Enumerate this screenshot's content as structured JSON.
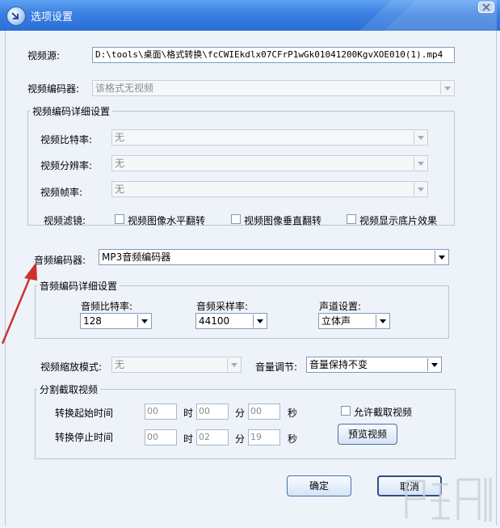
{
  "window": {
    "title": "选项设置"
  },
  "video": {
    "source_label": "视频源:",
    "source_path": "D:\\tools\\桌面\\格式转换\\fcCWIEkdlx07CFrP1wGk01041200KgvXOE010(1).mp4",
    "encoder_label": "视频编码器:",
    "encoder_value": "该格式无视频",
    "detail_title": "视频编码详细设置",
    "bitrate_label": "视频比特率:",
    "bitrate_value": "无",
    "resolution_label": "视频分辨率:",
    "resolution_value": "无",
    "framerate_label": "视频帧率:",
    "framerate_value": "无",
    "filter_label": "视频滤镜:",
    "filter_options": [
      "视频图像水平翻转",
      "视频图像垂直翻转",
      "视频显示底片效果"
    ]
  },
  "audio": {
    "encoder_label": "音频编码器:",
    "encoder_value": "MP3音频编码器",
    "detail_title": "音频编码详细设置",
    "bitrate_label": "音频比特率:",
    "bitrate_value": "128",
    "samplerate_label": "音频采样率:",
    "samplerate_value": "44100",
    "channel_label": "声道设置:",
    "channel_value": "立体声"
  },
  "misc": {
    "scale_label": "视频缩放模式:",
    "scale_value": "无",
    "volume_label": "音量调节:",
    "volume_value": "音量保持不变"
  },
  "split": {
    "title": "分割截取视频",
    "start_label": "转换起始时间",
    "stop_label": "转换停止时间",
    "hour_unit": "时",
    "minute_unit": "分",
    "second_unit": "秒",
    "start_hour": "00",
    "start_minute": "00",
    "start_second": "00",
    "stop_hour": "00",
    "stop_minute": "02",
    "stop_second": "19",
    "allow_label": "允许截取视频",
    "preview_button": "预览视频"
  },
  "buttons": {
    "ok": "确定",
    "cancel": "取消"
  },
  "colors": {
    "titlebar": "#3b7fe0",
    "annotation_arrow": "#d0312d",
    "panel": "#eef3fa"
  }
}
